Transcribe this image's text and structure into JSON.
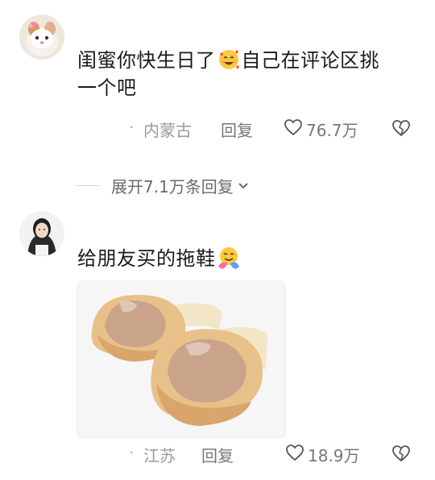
{
  "comments": [
    {
      "text_before_emoji": "闺蜜你快生日了",
      "emoji": "smiling-face-with-hearts",
      "text_after_emoji": "自己在评论区挑",
      "text_line2": "一个吧",
      "location": "内蒙古",
      "reply_label": "回复",
      "like_count": "76.7万"
    },
    {
      "text": "给朋友买的拖鞋",
      "emoji": "hugging-face",
      "location": "江苏",
      "reply_label": "回复",
      "like_count": "18.9万"
    }
  ],
  "expand": {
    "label": "展开7.1万条回复"
  },
  "colors": {
    "text": "#1a1a1a",
    "meta": "#8a8a8a",
    "slipper": "#e8c08a",
    "toe": "#c9a48a"
  }
}
